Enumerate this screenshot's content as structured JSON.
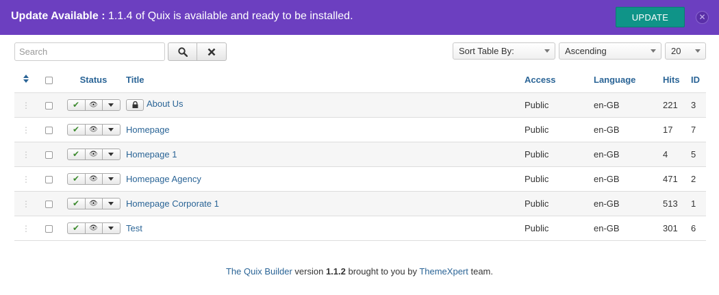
{
  "banner": {
    "prefix": "Update Available :",
    "message": " 1.1.4 of Quix is available and ready to be installed.",
    "update_label": "UPDATE",
    "close_glyph": "✕"
  },
  "toolbar": {
    "search_placeholder": "Search",
    "search_icon": "search-icon",
    "clear_icon": "clear-icon",
    "sort_by_label": "Sort Table By:",
    "order_label": "Ascending",
    "limit_label": "20"
  },
  "table": {
    "columns": {
      "status": "Status",
      "title": "Title",
      "access": "Access",
      "language": "Language",
      "hits": "Hits",
      "id": "ID"
    },
    "rows": [
      {
        "title": "About Us",
        "locked": true,
        "access": "Public",
        "language": "en-GB",
        "hits": "221",
        "id": "3"
      },
      {
        "title": "Homepage",
        "locked": false,
        "access": "Public",
        "language": "en-GB",
        "hits": "17",
        "id": "7"
      },
      {
        "title": "Homepage 1",
        "locked": false,
        "access": "Public",
        "language": "en-GB",
        "hits": "4",
        "id": "5"
      },
      {
        "title": "Homepage Agency",
        "locked": false,
        "access": "Public",
        "language": "en-GB",
        "hits": "471",
        "id": "2"
      },
      {
        "title": "Homepage Corporate 1",
        "locked": false,
        "access": "Public",
        "language": "en-GB",
        "hits": "513",
        "id": "1"
      },
      {
        "title": "Test",
        "locked": false,
        "access": "Public",
        "language": "en-GB",
        "hits": "301",
        "id": "6"
      }
    ]
  },
  "footer": {
    "product_link": "The Quix Builder",
    "version_word": " version ",
    "version": "1.1.2",
    "middle": " brought to you by ",
    "company_link": "ThemeXpert",
    "suffix": " team."
  },
  "colors": {
    "banner": "#6c3fc0",
    "update_button": "#0f9488",
    "link": "#2a6496",
    "publish_check": "#3c8a2e"
  }
}
